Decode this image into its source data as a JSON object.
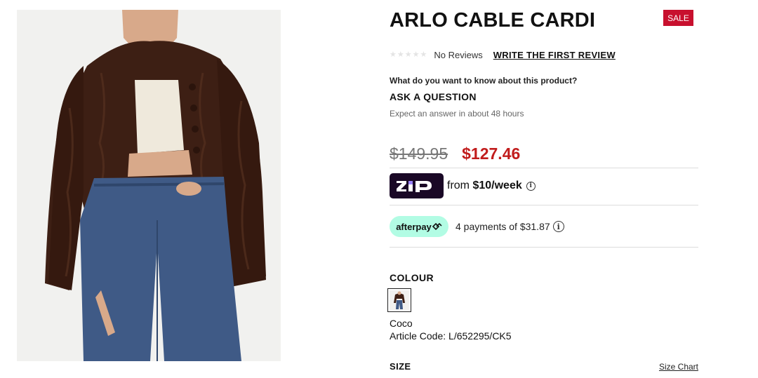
{
  "product": {
    "title": "ARLO CABLE CARDI",
    "badge": "SALE",
    "image_alt_icon": "product-photo"
  },
  "reviews": {
    "rating": 0,
    "stars_max": 5,
    "no_reviews_text": "No Reviews",
    "write_review_label": "WRITE THE FIRST REVIEW"
  },
  "question": {
    "prompt": "What do you want to know about this product?",
    "ask_label": "ASK A QUESTION",
    "note": "Expect an answer in about 48 hours"
  },
  "price": {
    "original": "$149.95",
    "sale": "$127.46"
  },
  "zip": {
    "logo_text": "zip",
    "text_prefix": "from ",
    "amount": "$10/week",
    "info_icon": "info-icon"
  },
  "afterpay": {
    "logo_text": "afterpay",
    "text": "4 payments of $31.87",
    "info_icon": "info-icon"
  },
  "colour": {
    "label": "COLOUR",
    "selected_name": "Coco",
    "article_code": "Article Code: L/652295/CK5"
  },
  "size": {
    "label": "SIZE",
    "chart_link": "Size Chart"
  },
  "colors": {
    "sale_red": "#c11c1c",
    "badge_red": "#c8102e",
    "zip_purple": "#1a0826",
    "afterpay_mint": "#b2fce4",
    "cardigan_brown": "#3d1f14"
  }
}
